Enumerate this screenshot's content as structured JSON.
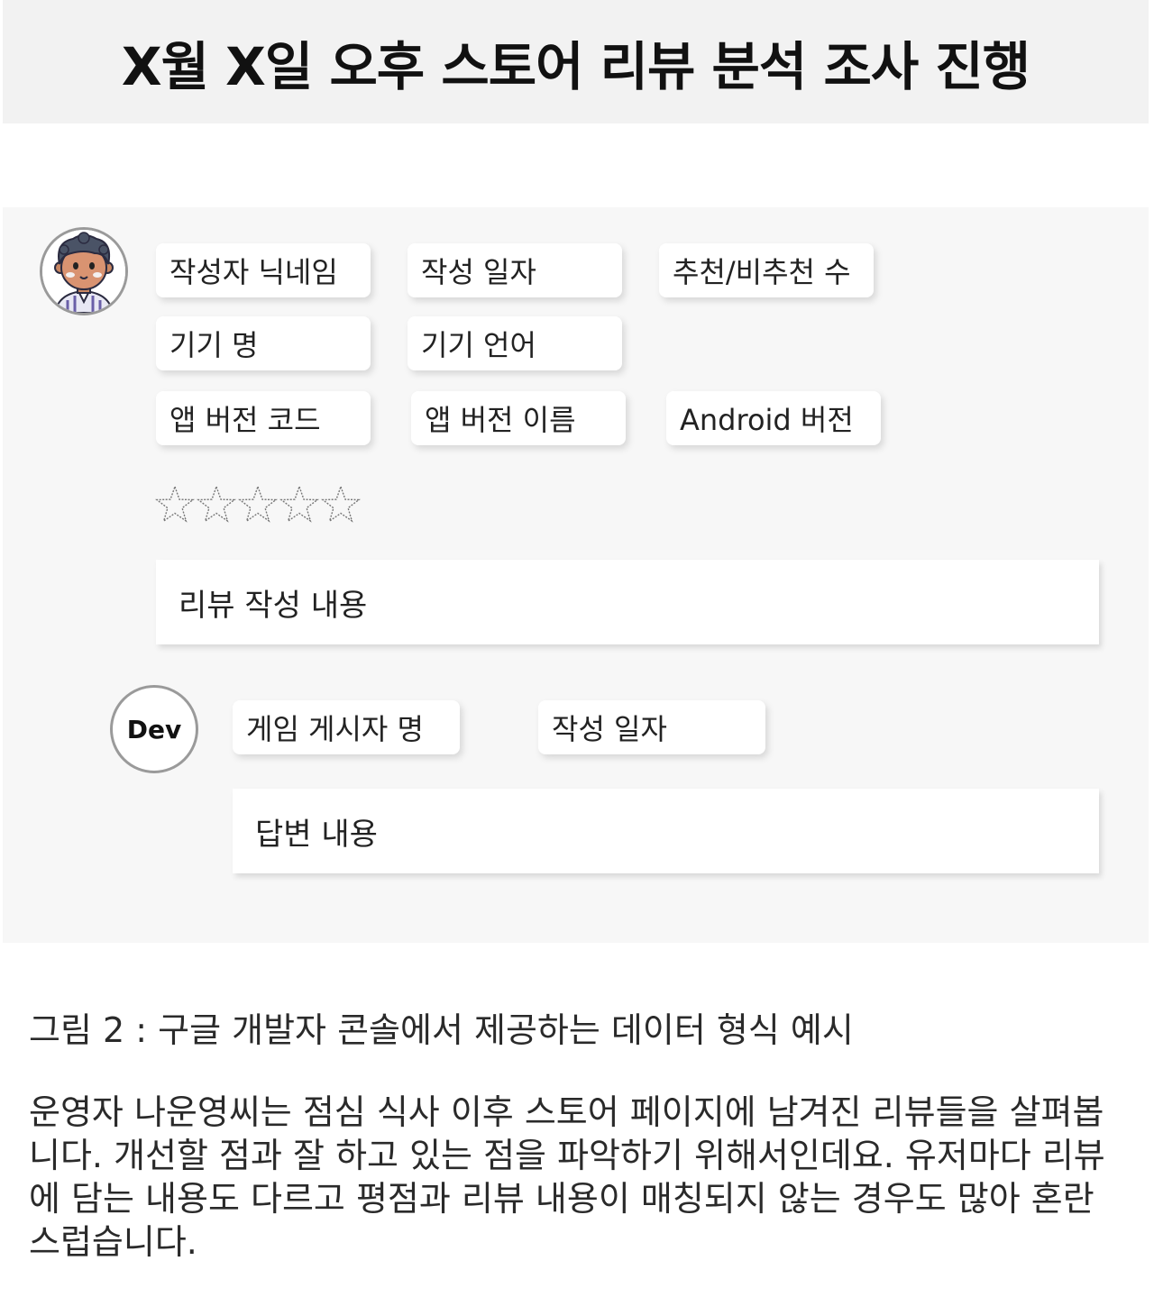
{
  "title": "X월 X일 오후 스토어 리뷰 분석 조사 진행",
  "review": {
    "fields_row1": [
      "작성자 닉네임",
      "작성 일자",
      "추천/비추천 수"
    ],
    "fields_row2": [
      "기기 명",
      "기기 언어"
    ],
    "fields_row3": [
      "앱 버전 코드",
      "앱 버전 이름",
      "Android 버전"
    ],
    "rating_stars": 5,
    "content": "리뷰 작성 내용"
  },
  "reply": {
    "avatar_label": "Dev",
    "fields": [
      "게임 게시자 명",
      "작성 일자"
    ],
    "content": "답변 내용"
  },
  "caption": "그림 2 : 구글 개발자 콘솔에서 제공하는 데이터 형식 예시",
  "paragraph": "운영자 나운영씨는 점심 식사 이후 스토어 페이지에 남겨진 리뷰들을 살펴봅니다. 개선할 점과 잘 하고 있는 점을 파악하기 위해서인데요. 유저마다 리뷰에 담는 내용도 다르고 평점과 리뷰 내용이 매칭되지 않는 경우도 많아 혼란스럽습니다."
}
